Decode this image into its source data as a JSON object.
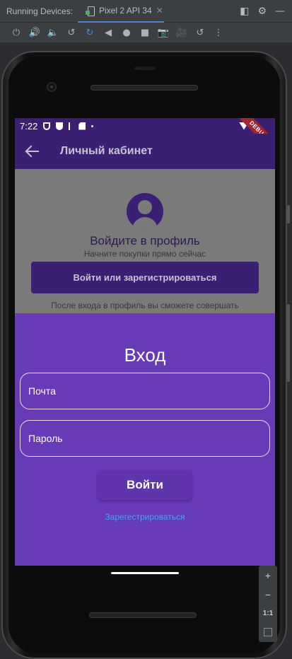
{
  "ide": {
    "running_devices_label": "Running Devices:",
    "device_tab_label": "Pixel 2 API 34",
    "close_symbol": "✕",
    "toolbar_icons": [
      "power-icon",
      "volume-up-icon",
      "volume-down-icon",
      "rotate-left-icon",
      "rotate-right-icon",
      "back-icon",
      "home-icon",
      "overview-icon",
      "screenshot-icon",
      "record-icon",
      "replay-icon",
      "more-icon"
    ]
  },
  "status_bar": {
    "time": "7:22",
    "debug_banner": "DEBUG"
  },
  "app_bar": {
    "title": "Личный кабинет"
  },
  "profile_page": {
    "title": "Войдите в профиль",
    "subtitle": "Начните покупки прямо сейчас",
    "login_button": "Войти или зарегистрироваться",
    "note": "После входа в профиль вы сможете совершать покупки в приложении"
  },
  "login_sheet": {
    "title": "Вход",
    "email_placeholder": "Почта",
    "password_placeholder": "Пароль",
    "submit_button": "Войти",
    "register_link": "Зарегестрироваться"
  },
  "zoom_controls": {
    "zoom_in": "+",
    "zoom_out": "−",
    "actual_size": "1:1"
  },
  "colors": {
    "primary_dark": "#3a1f73",
    "sheet_background": "#673ab7",
    "link": "#3fa9f5",
    "debug_banner": "#a02631"
  }
}
